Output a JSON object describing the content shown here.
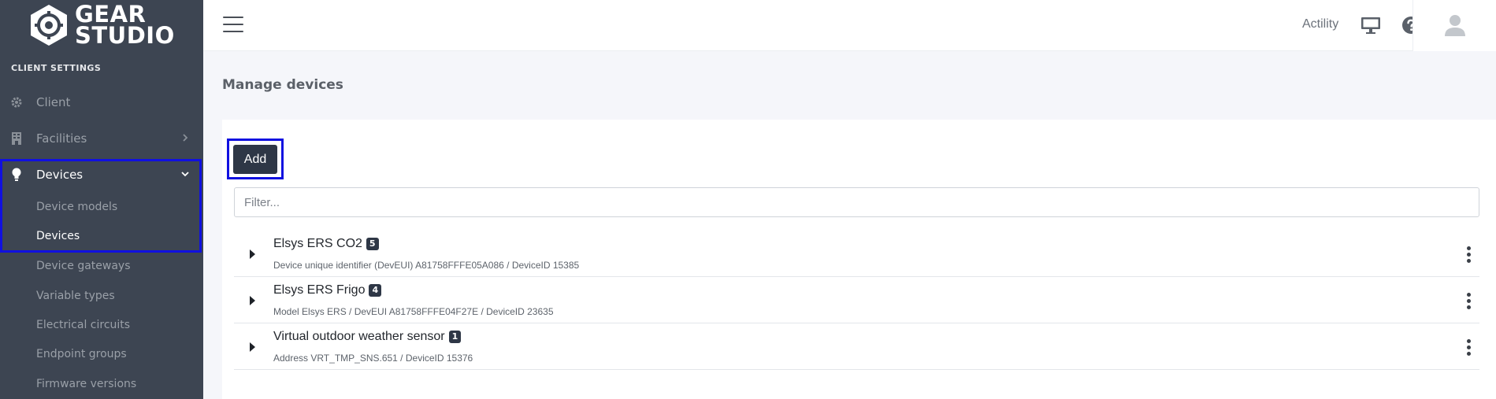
{
  "brand": {
    "line1": "GEAR",
    "line2": "STUDIO"
  },
  "sidebar": {
    "section_title": "CLIENT SETTINGS",
    "items": [
      {
        "label": "Client",
        "icon": "gear-icon"
      },
      {
        "label": "Facilities",
        "icon": "building-icon"
      },
      {
        "label": "Devices",
        "icon": "lightbulb-icon"
      }
    ],
    "sub_items": [
      {
        "label": "Device models"
      },
      {
        "label": "Devices"
      },
      {
        "label": "Device gateways"
      },
      {
        "label": "Variable types"
      },
      {
        "label": "Electrical circuits"
      },
      {
        "label": "Endpoint groups"
      },
      {
        "label": "Firmware versions"
      }
    ]
  },
  "topbar": {
    "brand_label": "Actility",
    "icons": [
      "monitor-icon",
      "help-icon",
      "user-icon"
    ]
  },
  "main": {
    "page_title": "Manage devices",
    "add_label": "Add",
    "filter_placeholder": "Filter...",
    "devices": [
      {
        "name": "Elsys ERS CO2",
        "badge": "5",
        "detail": "Device unique identifier (DevEUI) A81758FFFE05A086 / DeviceID 15385"
      },
      {
        "name": "Elsys ERS Frigo",
        "badge": "4",
        "detail": "Model Elsys ERS / DevEUI A81758FFFE04F27E / DeviceID 23635"
      },
      {
        "name": "Virtual outdoor weather sensor",
        "badge": "1",
        "detail": "Address VRT_TMP_SNS.651 / DeviceID 15376"
      }
    ]
  },
  "colors": {
    "sidebar_bg": "#3d4552",
    "accent_dark": "#2e3746",
    "highlight": "#1010e0"
  }
}
